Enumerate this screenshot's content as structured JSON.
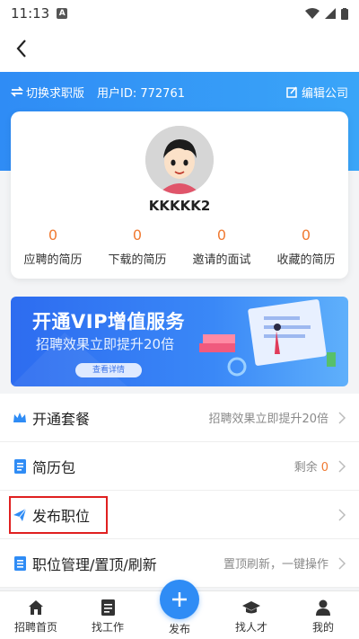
{
  "status_bar": {
    "time": "11:13",
    "notif_letter": "A"
  },
  "header": {
    "switch_label": "切换求职版",
    "user_id": "用户ID: 772761",
    "edit_label": "编辑公司"
  },
  "profile": {
    "username": "KKKKK2",
    "stats": [
      {
        "value": "0",
        "label": "应聘的简历"
      },
      {
        "value": "0",
        "label": "下载的简历"
      },
      {
        "value": "0",
        "label": "邀请的面试"
      },
      {
        "value": "0",
        "label": "收藏的简历"
      }
    ]
  },
  "banner": {
    "title": "开通VIP增值服务",
    "subtitle": "招聘效果立即提升20倍",
    "button": "查看详情"
  },
  "menu": [
    {
      "label": "开通套餐",
      "hint": "招聘效果立即提升20倍",
      "icon": "crown-icon"
    },
    {
      "label": "简历包",
      "hint": "剩余",
      "count": "0",
      "icon": "document-icon"
    },
    {
      "label": "发布职位",
      "hint": "",
      "icon": "paper-plane-icon"
    },
    {
      "label": "职位管理/置顶/刷新",
      "hint": "置顶刷新，一键操作",
      "icon": "list-icon"
    }
  ],
  "tabbar": {
    "tabs": [
      {
        "label": "招聘首页",
        "icon": "home-icon"
      },
      {
        "label": "找工作",
        "icon": "document-icon"
      },
      {
        "label": "找人才",
        "icon": "graduation-cap-icon"
      },
      {
        "label": "我的",
        "icon": "person-icon"
      }
    ],
    "publish_label": "发布"
  },
  "colors": {
    "primary": "#2f8cf5",
    "accent": "#f07a32",
    "highlight": "#e02020"
  }
}
